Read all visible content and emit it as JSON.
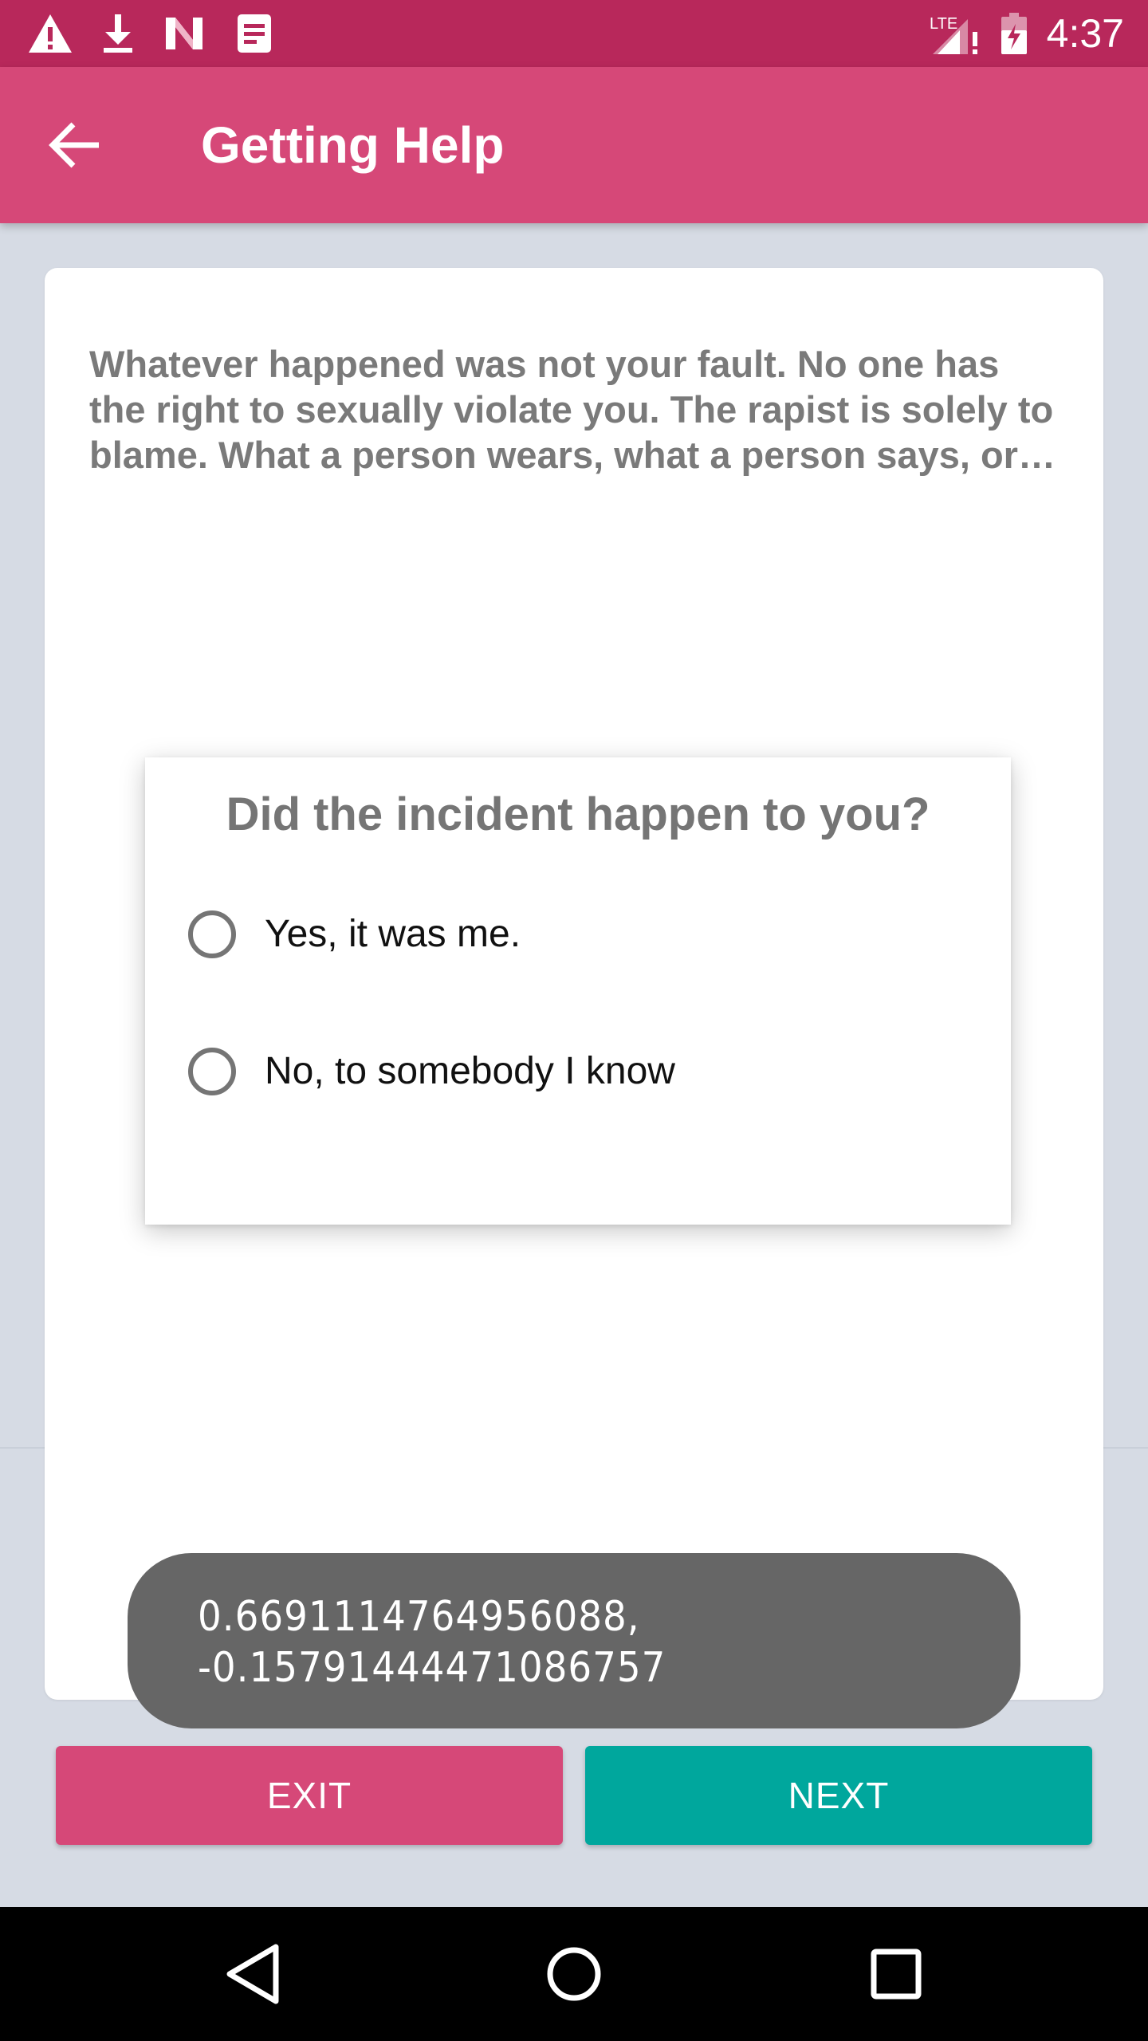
{
  "status_bar": {
    "time": "4:37",
    "network_label": "LTE",
    "icons": [
      "warning-icon",
      "download-icon",
      "n-logo-icon",
      "notes-icon",
      "signal-icon",
      "battery-icon"
    ]
  },
  "app_bar": {
    "title": "Getting Help",
    "back_icon": "arrow-back-icon"
  },
  "card": {
    "text": "Whatever happened was not your fault. No one has the right to sexually violate you. The rapist is solely to blame. What a person wears, what a person says, or h…"
  },
  "dialog": {
    "title": "Did the incident happen to you?",
    "options": [
      {
        "label": "Yes, it was me.",
        "selected": false
      },
      {
        "label": "No, to somebody I know",
        "selected": false
      }
    ]
  },
  "toast": {
    "text": "0.6691114764956088,\n-0.15791444471086757"
  },
  "buttons": {
    "exit_label": "EXIT",
    "next_label": "NEXT"
  },
  "colors": {
    "status_bar": "#b8285b",
    "app_bar": "#d64878",
    "exit_button": "#d64878",
    "next_button": "#00a79d",
    "background": "#d6dbe4",
    "toast": "#666666"
  }
}
